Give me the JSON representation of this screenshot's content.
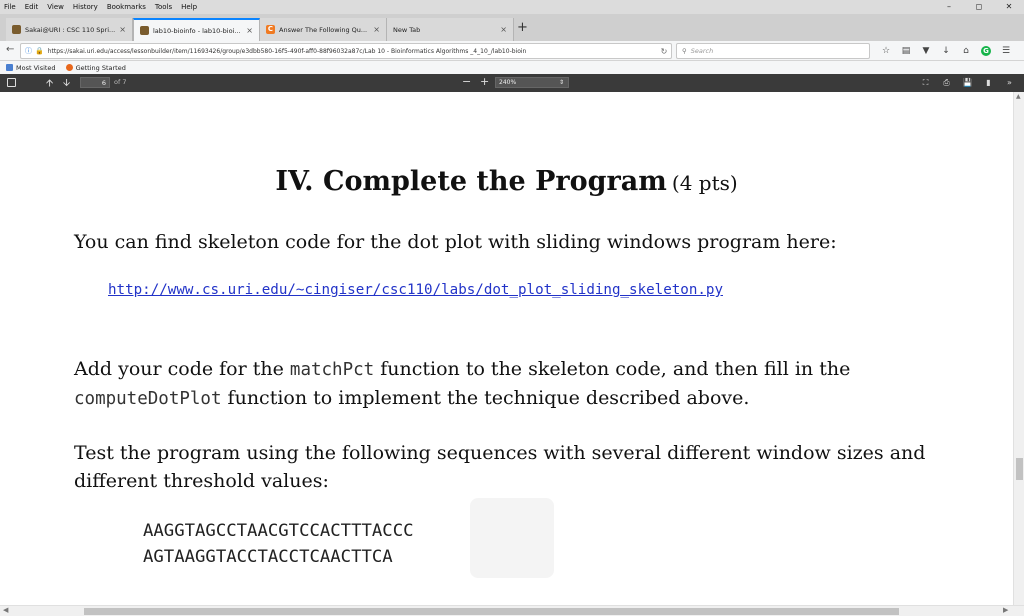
{
  "menu": [
    "File",
    "Edit",
    "View",
    "History",
    "Bookmarks",
    "Tools",
    "Help"
  ],
  "window_controls": {
    "minimize": "–",
    "maximize": "◻",
    "close": "✕"
  },
  "tabs": [
    {
      "title": "Sakai@URI : CSC 110 Spri...",
      "favicon_color": "#7a5c2e",
      "active": false
    },
    {
      "title": "lab10-bioinfo - lab10-bioi...",
      "favicon_color": "#7a5c2e",
      "active": true
    },
    {
      "title": "Answer The Following Qu...",
      "favicon_color": "#f07a22",
      "favicon_glyph": "C",
      "active": false
    },
    {
      "title": "New Tab",
      "active": false
    }
  ],
  "new_tab_glyph": "+",
  "tab_close_glyph": "×",
  "navbar": {
    "url": "https://sakai.uri.edu/access/lessonbuilder/item/11693426/group/e3dbb580-16f5-490f-aff0-88f96032a87c/Lab 10 - Bioinformatics Algorithms _4_10_/lab10-bioin",
    "search_placeholder": "Search",
    "icons": [
      "star-icon",
      "reader-icon",
      "pocket-icon",
      "download-icon",
      "home-icon",
      "grammarly-icon",
      "menu-icon"
    ]
  },
  "bookmarks": [
    {
      "label": "Most Visited",
      "color": "#4a7fd0"
    },
    {
      "label": "Getting Started",
      "color": "#e8671c"
    }
  ],
  "pdf_toolbar": {
    "page_current": "6",
    "page_of": "of 7",
    "zoom": "240%"
  },
  "document": {
    "heading": "IV. Complete the Program",
    "heading_pts": "(4 pts)",
    "p1": "You can find skeleton code for the dot plot with sliding windows program here:",
    "link": "http://www.cs.uri.edu/~cingiser/csc110/labs/dot_plot_sliding_skeleton.py",
    "p2_a": "Add your code for the ",
    "p2_code1": "matchPct",
    "p2_b": " function to the skeleton code, and then fill in the",
    "p2_code2": "computeDotPlot",
    "p2_c": " function to implement the technique described above.",
    "p3_line1": "Test the program using the following sequences with several different window sizes and",
    "p3_line2": "different threshold values:",
    "seq1": "AAGGTAGCCTAACGTCCACTTTACCC",
    "seq2": "AGTAAGGTACCTACCTCAACTTCA"
  }
}
